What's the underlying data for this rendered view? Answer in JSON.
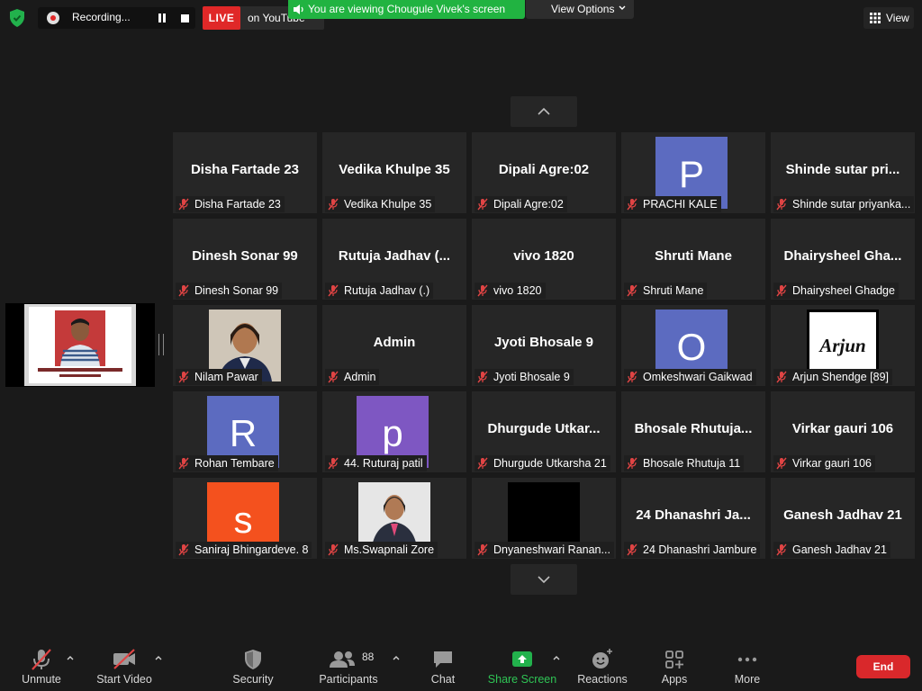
{
  "topbar": {
    "recording_label": "Recording...",
    "live_badge": "LIVE",
    "live_destination": "on YouTube",
    "share_banner": "You are viewing Chougule Vivek's screen",
    "view_options_label": "View Options",
    "view_label": "View"
  },
  "tiles": [
    {
      "big": "Disha Fartade 23",
      "name": "Disha Fartade 23"
    },
    {
      "big": "Vedika Khulpe 35",
      "name": "Vedika Khulpe 35"
    },
    {
      "big": "Dipali Agre:02",
      "name": "Dipali Agre:02"
    },
    {
      "avatar": "P",
      "avatar_color": "#5c6bc0",
      "name": "PRACHI KALE"
    },
    {
      "big": "Shinde sutar pri...",
      "name": "Shinde sutar priyanka..."
    },
    {
      "big": "Dinesh Sonar 99",
      "name": "Dinesh Sonar 99"
    },
    {
      "big": "Rutuja Jadhav (...",
      "name": "Rutuja Jadhav (.)"
    },
    {
      "big": "vivo 1820",
      "name": "vivo 1820"
    },
    {
      "big": "Shruti Mane",
      "name": "Shruti Mane"
    },
    {
      "big": "Dhairysheel Gha...",
      "name": "Dhairysheel Ghadge"
    },
    {
      "photo": "woman-portrait",
      "name": "Nilam Pawar"
    },
    {
      "big": "Admin",
      "name": "Admin"
    },
    {
      "big": "Jyoti Bhosale 9",
      "name": "Jyoti Bhosale 9"
    },
    {
      "avatar": "O",
      "avatar_color": "#5c6bc0",
      "name": "Omkeshwari Gaikwad"
    },
    {
      "photo": "arjun-logo",
      "logo_text": "Arjun",
      "name": "Arjun Shendge [89]"
    },
    {
      "avatar": "R",
      "avatar_color": "#5c6bc0",
      "name": "Rohan Tembare"
    },
    {
      "avatar": "p",
      "avatar_color": "#7e57c2",
      "name": "44. Ruturaj patil"
    },
    {
      "big": "Dhurgude Utkar...",
      "name": "Dhurgude Utkarsha 21"
    },
    {
      "big": "Bhosale Rhutuja...",
      "name": "Bhosale Rhutuja 11"
    },
    {
      "big": "Virkar gauri 106",
      "name": "Virkar gauri 106"
    },
    {
      "avatar": "s",
      "avatar_color": "#f4511e",
      "name": "Saniraj Bhingardeve. 8"
    },
    {
      "photo": "woman-blazer",
      "name": "Ms.Swapnali Zore"
    },
    {
      "photo": "black",
      "name": "Dnyaneshwari Ranan..."
    },
    {
      "big": "24 Dhanashri Ja...",
      "name": "24 Dhanashri Jambure"
    },
    {
      "big": "Ganesh Jadhav 21",
      "name": "Ganesh Jadhav 21"
    }
  ],
  "toolbar": {
    "unmute": "Unmute",
    "start_video": "Start Video",
    "security": "Security",
    "participants": "Participants",
    "participants_count": "88",
    "chat": "Chat",
    "share_screen": "Share Screen",
    "reactions": "Reactions",
    "apps": "Apps",
    "more": "More",
    "end": "End"
  },
  "colors": {
    "live_red": "#e02828",
    "share_green": "#21b341",
    "end_red": "#d9282b",
    "muted_mic_red": "#e04444"
  }
}
